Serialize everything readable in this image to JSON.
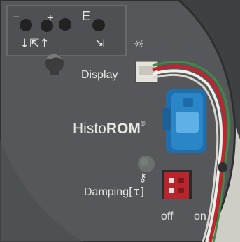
{
  "panel": {
    "key_labels": {
      "minus": "−",
      "plus": "+",
      "escape": "E"
    },
    "key_symbols": {
      "down_arrow": "↓",
      "escape_box": "⇱",
      "up_arrow": "↑",
      "exit_box": "⇲",
      "brightness": "☼"
    },
    "display_label": "Display",
    "brand_plain": "Histo",
    "brand_bold": "ROM",
    "brand_mark": "®",
    "lock_symbol": "⚷",
    "damping_label": "Damping",
    "damping_symbol": "[τ]",
    "switch_off": "off",
    "switch_on": "on"
  },
  "colors": {
    "panel": "#5a5a5c",
    "connector_blue": "#2b86c8",
    "dip_switch": "#b8252c",
    "wire_red": "#c0242c",
    "wire_white": "#eeeeea",
    "wire_green": "#3f8a47"
  }
}
